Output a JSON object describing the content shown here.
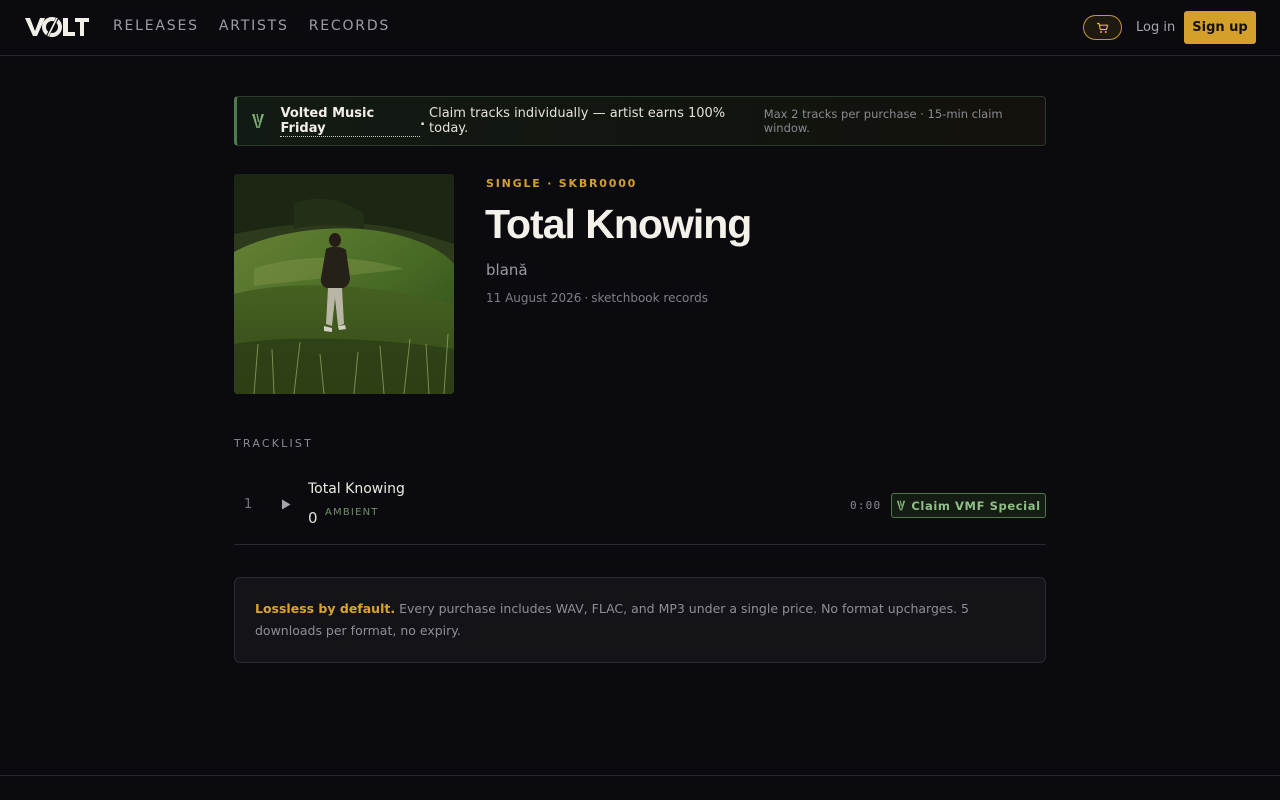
{
  "header": {
    "logo_text": "VOLT",
    "nav": [
      "RELEASES",
      "ARTISTS",
      "RECORDS"
    ],
    "cart_icon": "cart-icon",
    "login_label": "Log in",
    "signup_label": "Sign up"
  },
  "banner": {
    "icon": "volt-v-icon",
    "title": "Volted Music Friday",
    "title_tail": ".",
    "main": "Claim tracks individually — artist earns 100% today.",
    "note": "Max 2 tracks per purchase · 15-min claim window."
  },
  "release": {
    "eyebrow": "SINGLE · SKBR0000",
    "title": "Total Knowing",
    "artist": "blană",
    "date": "11 August 2026",
    "meta_sep": "·",
    "label": "sketchbook records"
  },
  "tracklist": {
    "heading": "TRACKLIST",
    "tracks": [
      {
        "number": "1",
        "title": "Total Knowing",
        "count": "0",
        "genre": "AMBIENT",
        "duration": "0:00",
        "claim_label": "Claim VMF Special"
      }
    ]
  },
  "info": {
    "lead": "Lossless by default.",
    "text": "Every purchase includes WAV, FLAC, and MP3 under a single price. No format upcharges. 5 downloads per format, no expiry."
  },
  "colors": {
    "accent": "#d4a02a",
    "green": "#8fbf86",
    "background": "#0b0b0f"
  }
}
